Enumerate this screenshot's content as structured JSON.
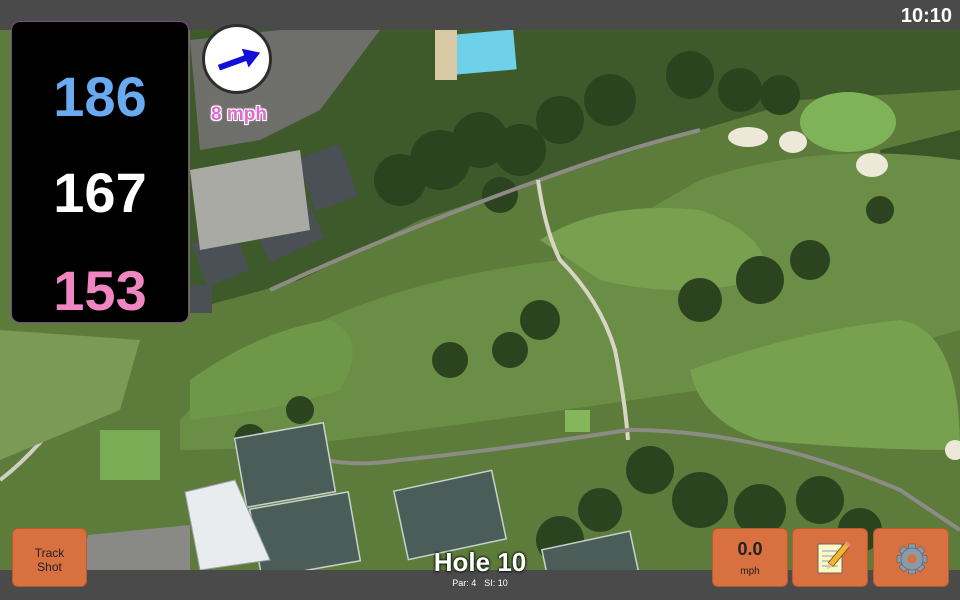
{
  "status": {
    "time": "10:10"
  },
  "yardages": {
    "back": "186",
    "middle": "167",
    "front": "153"
  },
  "wind": {
    "speed": "8 mph",
    "icon": "wind-arrow-icon"
  },
  "buttons": {
    "track_shot": "Track\nShot",
    "speed_value": "0.0",
    "speed_unit": "mph",
    "notes_icon": "notepad-icon",
    "settings_icon": "gear-icon"
  },
  "hole": {
    "title": "Hole 10",
    "par": "Par: 4",
    "si": "SI: 10"
  },
  "colors": {
    "back_yardage": "#6aaaf0",
    "middle_yardage": "#ffffff",
    "front_yardage": "#ef86c2",
    "button": "#d9703f",
    "wind_text": "#e06ad0"
  }
}
